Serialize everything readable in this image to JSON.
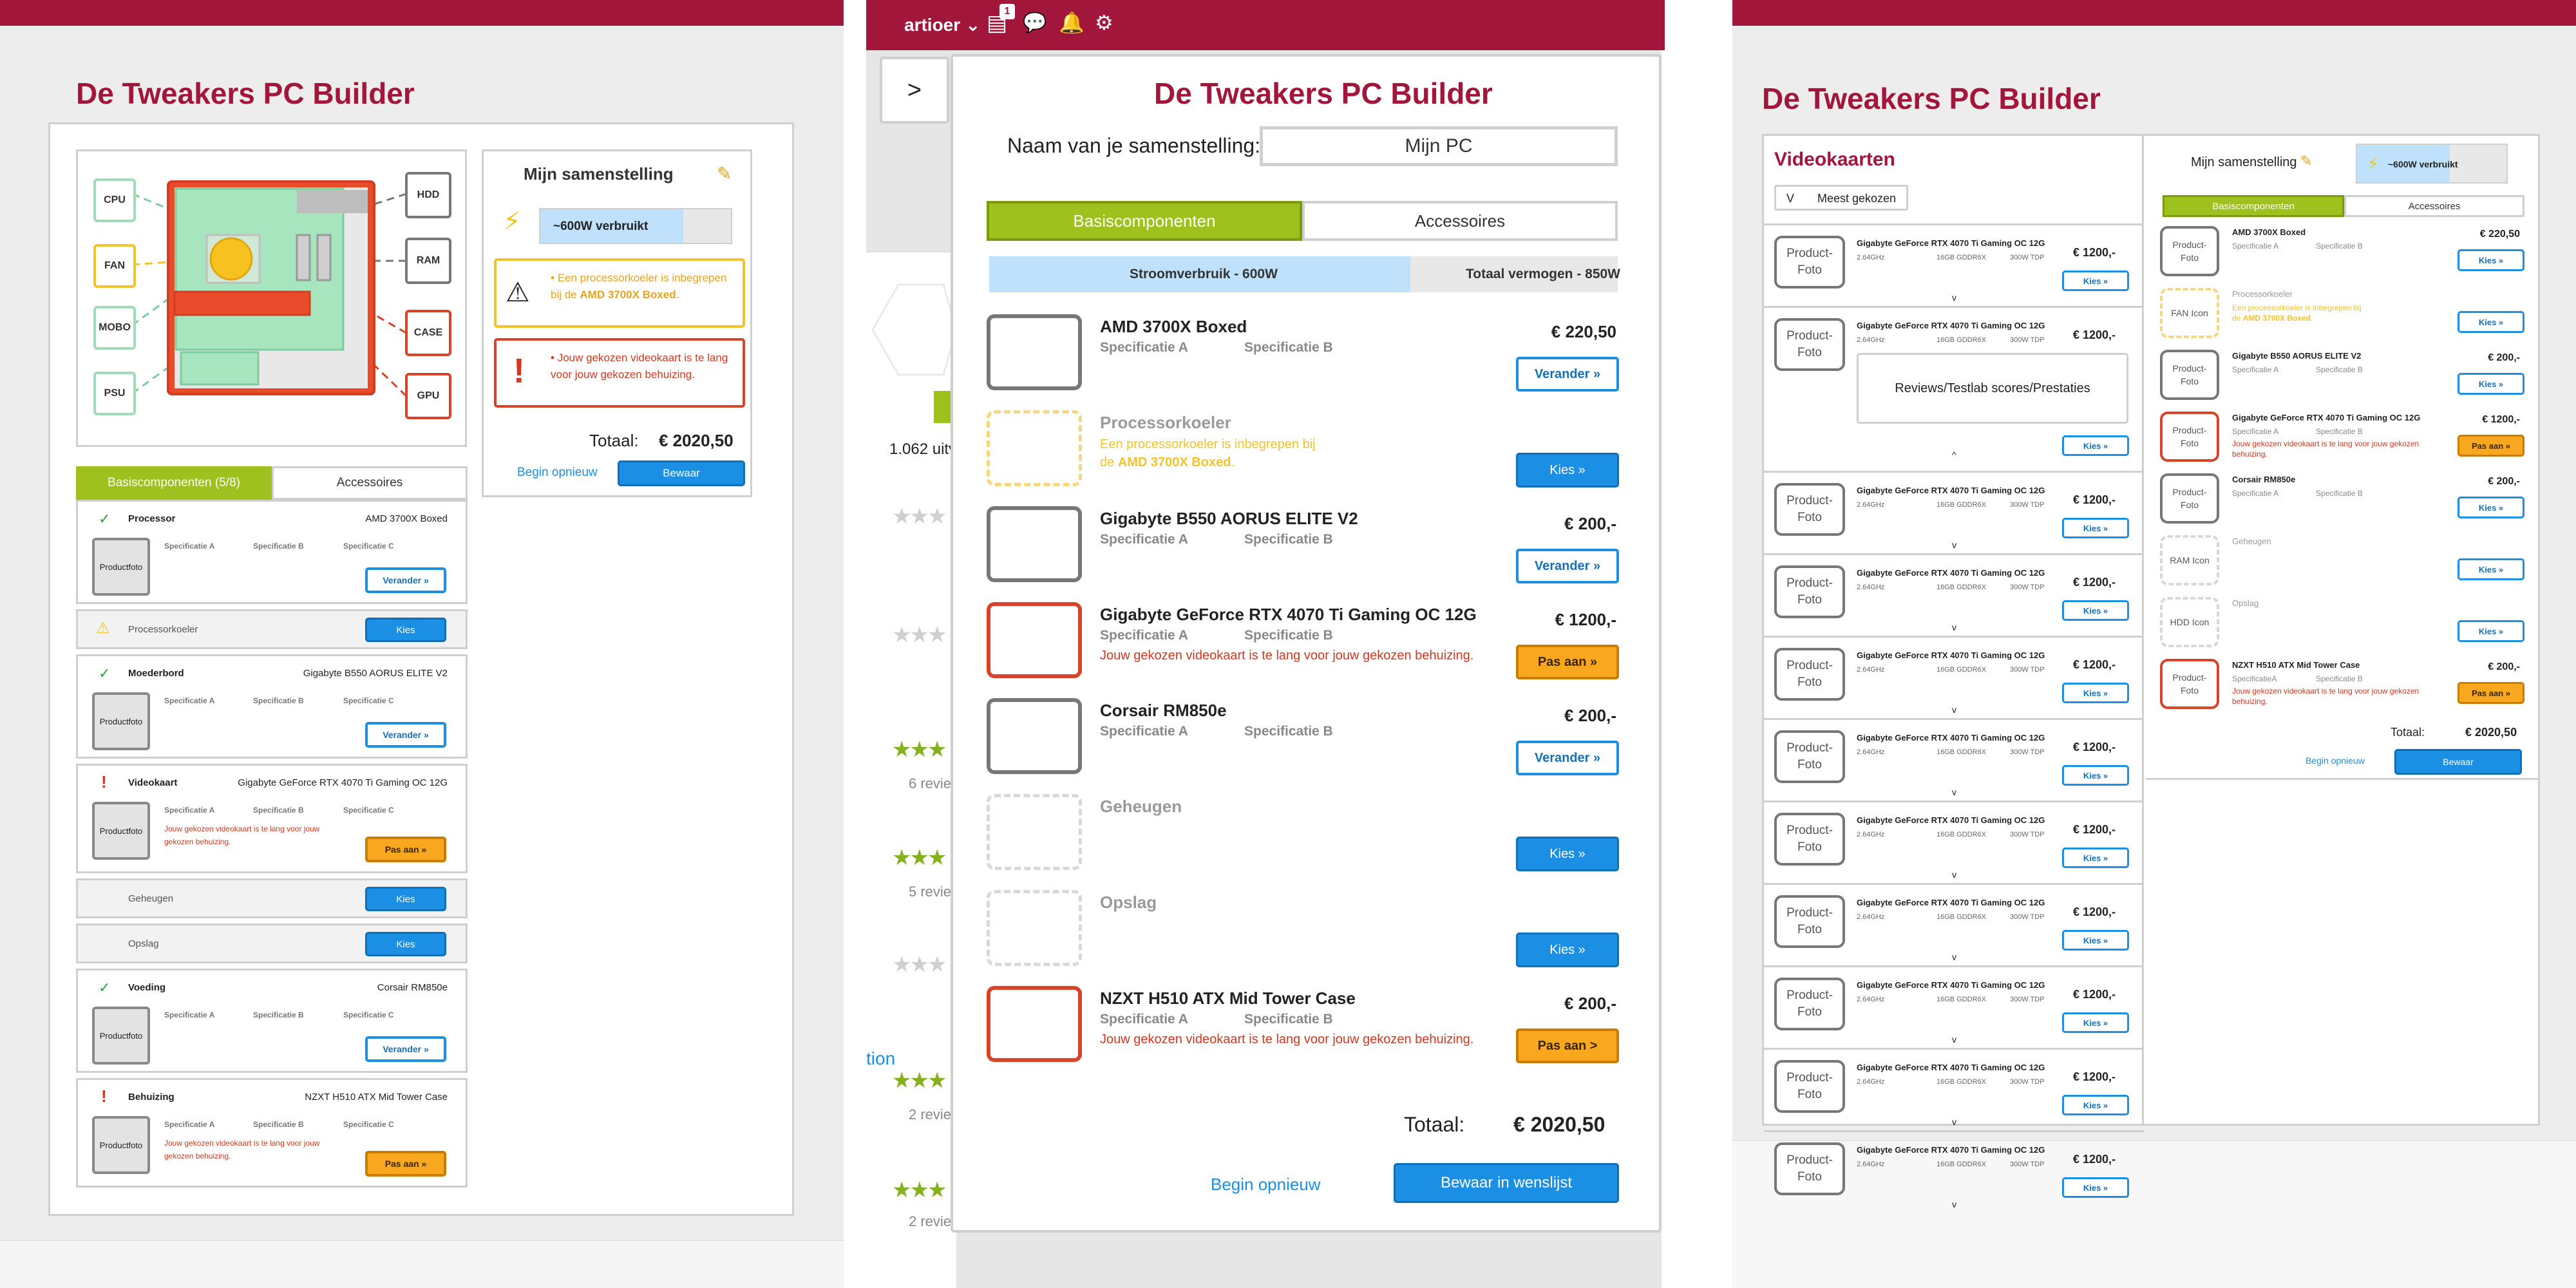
{
  "screens": {
    "left": {
      "title": "De Tweakers PC Builder",
      "diagram_labels": [
        "CPU",
        "FAN",
        "MOBO",
        "PSU",
        "HDD",
        "RAM",
        "CASE",
        "GPU"
      ],
      "summary": {
        "title": "Mijn samenstelling",
        "power": "~600W verbruikt",
        "power_fraction": 0.75,
        "warning": {
          "text": "Een processorkoeler is inbegrepen bij de ",
          "strong": "AMD 3700X Boxed",
          "tail": "."
        },
        "error": "Jouw gekozen videokaart is te lang voor jouw gekozen behuizing.",
        "total_label": "Totaal:",
        "total_value": "€ 2020,50",
        "restart": "Begin opnieuw",
        "save": "Bewaar"
      },
      "tabs": [
        "Basiscomponenten (5/8)",
        "Accessoires"
      ],
      "rows": [
        {
          "status": "check",
          "type": "Processor",
          "name": "AMD 3700X Boxed",
          "spec_a": "Specificatie A",
          "spec_b": "Specificatie B",
          "spec_c": "Specificatie C",
          "photo": "Productfoto",
          "button": "Verander »",
          "kind": "white"
        },
        {
          "status": "warn",
          "type": "Processorkoeler",
          "button": "Kies",
          "kind": "blue"
        },
        {
          "status": "check",
          "type": "Moederbord",
          "name": "Gigabyte B550 AORUS ELITE V2",
          "spec_a": "Specificatie A",
          "spec_b": "Specificatie B",
          "spec_c": "Specificatie C",
          "photo": "Productfoto",
          "button": "Verander »",
          "kind": "white"
        },
        {
          "status": "error",
          "type": "Videokaart",
          "name": "Gigabyte GeForce RTX 4070 Ti Gaming OC 12G",
          "spec_a": "Specificatie A",
          "spec_b": "Specificatie B",
          "spec_c": "Specificatie C",
          "photo": "Productfoto",
          "error": "Jouw gekozen videokaart is te lang voor jouw gekozen behuizing.",
          "button": "Pas aan »",
          "kind": "orange"
        },
        {
          "status": "none",
          "type": "Geheugen",
          "button": "Kies",
          "kind": "blue"
        },
        {
          "status": "none",
          "type": "Opslag",
          "button": "Kies",
          "kind": "blue"
        },
        {
          "status": "check",
          "type": "Voeding",
          "name": "Corsair RM850e",
          "spec_a": "Specificatie A",
          "spec_b": "Specificatie B",
          "spec_c": "Specificatie C",
          "photo": "Productfoto",
          "button": "Verander »",
          "kind": "white"
        },
        {
          "status": "error",
          "type": "Behuizing",
          "name": "NZXT H510 ATX Mid Tower Case",
          "spec_a": "Specificatie A",
          "spec_b": "Specificatie B",
          "spec_c": "Specificatie C",
          "photo": "Productfoto",
          "error": "Jouw gekozen videokaart is te lang voor jouw gekozen behuizing.",
          "button": "Pas aan »",
          "kind": "orange"
        }
      ]
    },
    "middle": {
      "topbar": {
        "user": "artioer",
        "notif_count": "1"
      },
      "toggle": ">",
      "title": "De Tweakers PC Builder",
      "name_label": "Naam van je samenstelling:",
      "name_value": "Mijn PC",
      "tabs": [
        "Basiscomponenten",
        "Accessoires"
      ],
      "power_used": "Stroomverbruik - 600W",
      "power_total": "Totaal vermogen - 850W",
      "power_fraction": 0.67,
      "bg_texts": [
        "1.062 uitv",
        "6 revie",
        "5 revie",
        "tion",
        "2 revie",
        "2 revie"
      ],
      "components": [
        {
          "photo": "Product-\nFoto",
          "style": "grey",
          "name": "AMD 3700X Boxed",
          "spec_a": "Specificatie A",
          "spec_b": "Specificatie B",
          "price": "€ 220,50",
          "button": "Verander »",
          "kind": "white"
        },
        {
          "photo": "FAN Icon",
          "style": "ydash",
          "name": "Processorkoeler",
          "note": "Een processorkoeler is inbegrepen bij",
          "note2_pre": "de ",
          "note2_strong": "AMD 3700X Boxed",
          "note2_tail": ".",
          "button": "Kies »",
          "kind": "blue"
        },
        {
          "photo": "Product-\nFoto",
          "style": "grey",
          "name": "Gigabyte B550 AORUS ELITE V2",
          "spec_a": "Specificatie A",
          "spec_b": "Specificatie B",
          "price": "€ 200,-",
          "button": "Verander »",
          "kind": "white"
        },
        {
          "photo": "Product-\nFoto",
          "style": "red",
          "name": "Gigabyte GeForce RTX 4070 Ti Gaming OC 12G",
          "spec_a": "Specificatie A",
          "spec_b": "Specificatie B",
          "price": "€ 1200,-",
          "error": "Jouw gekozen videokaart is te lang voor jouw gekozen behuizing.",
          "button": "Pas aan »",
          "kind": "orange"
        },
        {
          "photo": "Product-\nFoto",
          "style": "grey",
          "name": "Corsair RM850e",
          "spec_a": "Specificatie A",
          "spec_b": "Specificatie B",
          "price": "€ 200,-",
          "button": "Verander »",
          "kind": "white"
        },
        {
          "photo": "RAM Icon",
          "style": "dash",
          "name": "Geheugen",
          "button": "Kies »",
          "kind": "blue"
        },
        {
          "photo": "HDD Icon",
          "style": "dash",
          "name": "Opslag",
          "button": "Kies »",
          "kind": "blue"
        },
        {
          "photo": "Product-\nFoto",
          "style": "red",
          "name": "NZXT H510 ATX Mid Tower Case",
          "spec_a": "Specificatie A",
          "spec_b": "Specificatie B",
          "price": "€ 200,-",
          "error": "Jouw gekozen videokaart is te lang voor jouw gekozen behuizing.",
          "button": "Pas aan >",
          "kind": "orange"
        }
      ],
      "total_label": "Totaal:",
      "total_value": "€ 2020,50",
      "restart": "Begin opnieuw",
      "save": "Bewaar in wenslijst"
    },
    "right": {
      "title": "De Tweakers PC Builder",
      "list_title": "Videokaarten",
      "sort_v": "V",
      "sort": "Meest gekozen",
      "products": {
        "photo": "Product-\nFoto",
        "name": "Gigabyte GeForce RTX 4070 Ti Gaming OC 12G",
        "spec1": "2.64GHz",
        "spec2": "16GB GDDR6X",
        "spec3": "300W TDP",
        "price": "€ 1200,-",
        "button": "Kies »",
        "chev_down": "v",
        "chev_up": "^",
        "expanded": "Reviews/Testlab scores/Prestaties",
        "count": 11
      },
      "summary": {
        "title": "Mijn samenstelling",
        "power": "~600W verbruikt",
        "tabs": [
          "Basiscomponenten",
          "Accessoires"
        ],
        "items": [
          {
            "photo": "Product-\nFoto",
            "style": "grey",
            "name": "AMD 3700X Boxed",
            "spec_a": "Specificatie A",
            "spec_b": "Specificatie B",
            "price": "€ 220,50",
            "button": "Kies »",
            "kind": "white"
          },
          {
            "photo": "FAN Icon",
            "style": "ydash",
            "name": "Processorkoeler",
            "note": "Een processorkoeler is inbegrepen bij",
            "note2_pre": "de ",
            "note2_strong": "AMD 3700X Boxed",
            "note2_tail": ".",
            "button": "Kies »",
            "kind": "white"
          },
          {
            "photo": "Product-\nFoto",
            "style": "grey",
            "name": "Gigabyte B550 AORUS ELITE V2",
            "spec_a": "Specificatie A",
            "spec_b": "Specificatie B",
            "price": "€ 200,-",
            "button": "Kies »",
            "kind": "white"
          },
          {
            "photo": "Product-\nFoto",
            "style": "red",
            "name": "Gigabyte GeForce RTX 4070 Ti Gaming OC 12G",
            "spec_a": "Specificatie A",
            "spec_b": "Specificatie B",
            "price": "€ 1200,-",
            "error": "Jouw gekozen videokaart is te lang voor jouw gekozen behuizing.",
            "button": "Pas aan »",
            "kind": "orange"
          },
          {
            "photo": "Product-\nFoto",
            "style": "grey",
            "name": "Corsair RM850e",
            "spec_a": "Specificatie A",
            "spec_b": "Specificatie B",
            "price": "€ 200,-",
            "button": "Kies »",
            "kind": "white"
          },
          {
            "photo": "RAM Icon",
            "style": "dash",
            "name": "Geheugen",
            "button": "Kies »",
            "kind": "white"
          },
          {
            "photo": "HDD Icon",
            "style": "dash",
            "name": "Opslag",
            "button": "Kies »",
            "kind": "white"
          },
          {
            "photo": "Product-\nFoto",
            "style": "red",
            "name": "NZXT H510 ATX Mid Tower Case",
            "spec_a": "SpecificatieA",
            "spec_b": "Specificatie B",
            "price": "€ 200,-",
            "error": "Jouw gekozen videokaart is te lang voor jouw gekozen behuizing.",
            "button": "Pas aan »",
            "kind": "orange"
          }
        ],
        "total_label": "Totaal:",
        "total_value": "€ 2020,50",
        "restart": "Begin opnieuw",
        "save": "Bewaar"
      }
    }
  },
  "colors": {
    "brand": "#a3163c",
    "green": "#9ec11d",
    "blue": "#1a8fe3",
    "orange": "#f8a71f",
    "error": "#d6361f",
    "warning": "#e8a31c"
  }
}
